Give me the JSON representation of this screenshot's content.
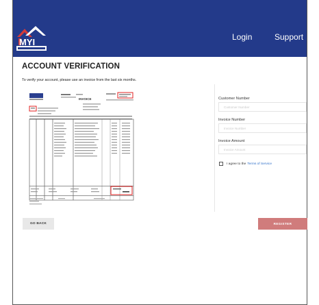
{
  "header": {
    "logo_name": "MYI logo",
    "nav": {
      "login": "Login",
      "support": "Support"
    }
  },
  "page": {
    "title": "ACCOUNT VERIFICATION",
    "instructions": "To verify your account, please use an invoice from the last six months."
  },
  "invoice_sample": {
    "doc_label": "INVOICE"
  },
  "form": {
    "customer_number": {
      "label": "Customer Number",
      "placeholder": "Customer Number",
      "value": ""
    },
    "invoice_number": {
      "label": "Invoice Number",
      "placeholder": "Invoice Number",
      "value": ""
    },
    "invoice_amount": {
      "label": "Invoice Amount",
      "placeholder": "Invoice Amount",
      "value": ""
    },
    "terms": {
      "prefix": "I agree to the",
      "link": "Terms of Service",
      "checked": false
    }
  },
  "actions": {
    "go_back": "GO BACK",
    "register": "REGISTER"
  },
  "colors": {
    "header_bg": "#233a8a",
    "register_bg": "#d07c7c",
    "link": "#2f6fc9",
    "highlight": "#e02020"
  }
}
